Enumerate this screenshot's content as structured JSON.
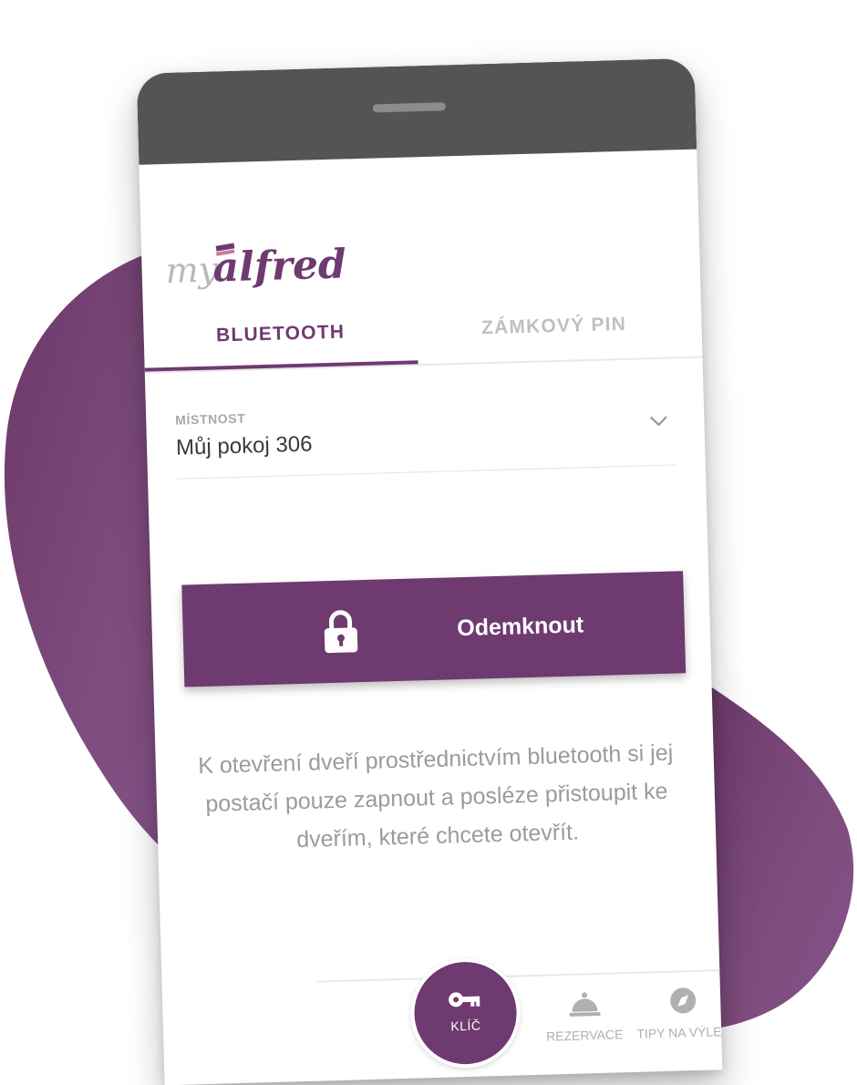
{
  "app": {
    "logo_text": "myalfred",
    "brand_color": "#6e3a6f"
  },
  "tabs": [
    {
      "label": "BLUETOOTH",
      "active": true
    },
    {
      "label": "ZÁMKOVÝ PIN",
      "active": false
    }
  ],
  "room_select": {
    "label": "MÍSTNOST",
    "value": "Můj pokoj 306",
    "icon": "chevron-down-icon"
  },
  "unlock_button": {
    "label": "Odemknout",
    "icon": "lock-icon"
  },
  "info_text": "K otevření dveří prostřednictvím bluetooth si jej postačí pouze zapnout a posléze přistoupit ke dveřím, které chcete otevřít.",
  "bottom_nav": [
    {
      "label": "KLÍČ",
      "icon": "key-icon",
      "active": true
    },
    {
      "label": "REZERVACE",
      "icon": "service-bell-icon",
      "active": false
    },
    {
      "label": "TIPY NA VÝLET",
      "icon": "compass-icon",
      "active": false
    }
  ]
}
